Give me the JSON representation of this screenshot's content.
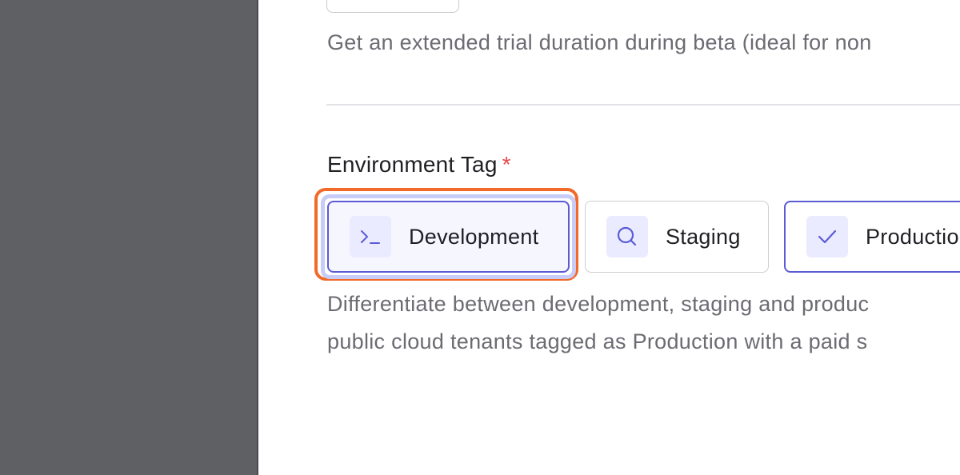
{
  "form": {
    "trial_help": "Get an extended trial duration during beta (ideal for non",
    "environment_tag": {
      "label": "Environment Tag",
      "required_mark": "*",
      "options": [
        {
          "label": "Development",
          "icon": "terminal-icon",
          "state": "focused"
        },
        {
          "label": "Staging",
          "icon": "search-icon",
          "state": "default"
        },
        {
          "label": "Productio",
          "icon": "check-icon",
          "state": "selected"
        }
      ],
      "help_line_1": "Differentiate between development, staging and produc",
      "help_line_2": "public cloud tenants tagged as Production with a paid s"
    }
  },
  "colors": {
    "sidebar": "#5f6064",
    "accent": "#5b5bd6",
    "highlight": "#f26a2a",
    "required": "#e5484d"
  }
}
